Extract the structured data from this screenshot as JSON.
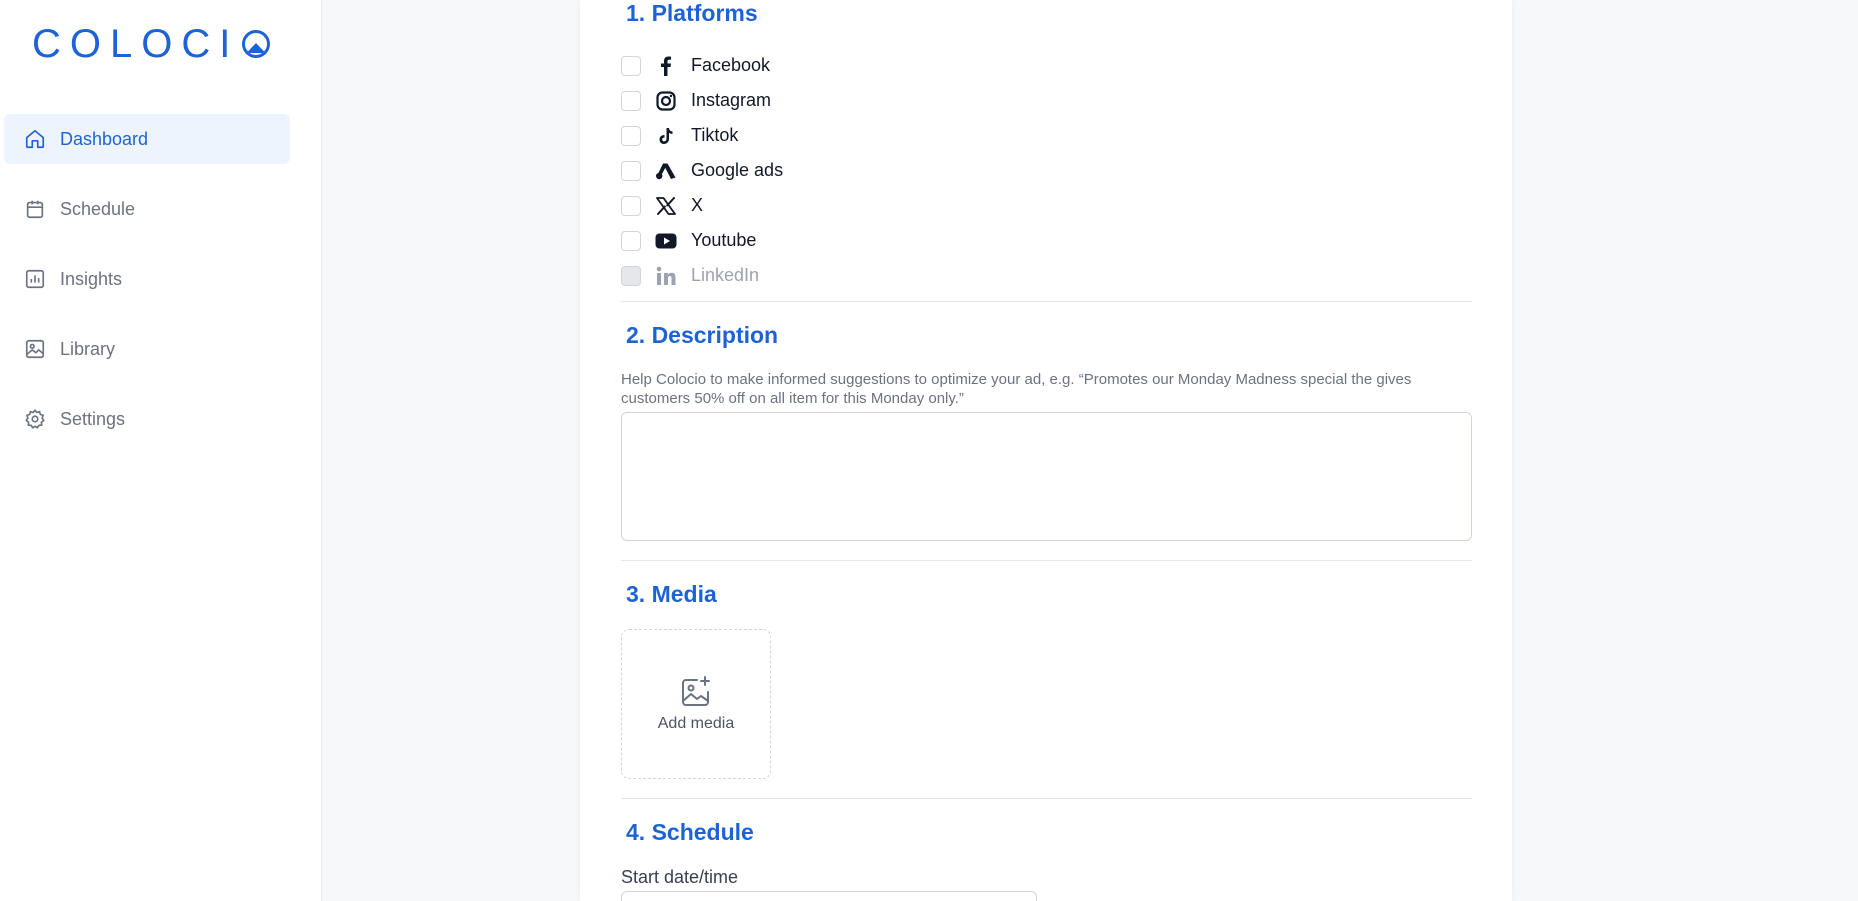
{
  "brand": {
    "logo_text": "COLOCI",
    "accent": "#1e63d6"
  },
  "sidebar": {
    "items": [
      {
        "label": "Dashboard",
        "icon": "home-icon",
        "active": true
      },
      {
        "label": "Schedule",
        "icon": "calendar-icon"
      },
      {
        "label": "Insights",
        "icon": "bar-chart-icon"
      },
      {
        "label": "Library",
        "icon": "image-icon"
      },
      {
        "label": "Settings",
        "icon": "gear-icon"
      }
    ]
  },
  "form": {
    "platforms": {
      "title": "1. Platforms",
      "options": [
        {
          "label": "Facebook",
          "icon": "facebook-icon",
          "checked": false,
          "disabled": false
        },
        {
          "label": "Instagram",
          "icon": "instagram-icon",
          "checked": false,
          "disabled": false
        },
        {
          "label": "Tiktok",
          "icon": "tiktok-icon",
          "checked": false,
          "disabled": false
        },
        {
          "label": "Google ads",
          "icon": "google-ads-icon",
          "checked": false,
          "disabled": false
        },
        {
          "label": "X",
          "icon": "x-icon",
          "checked": false,
          "disabled": false
        },
        {
          "label": "Youtube",
          "icon": "youtube-icon",
          "checked": false,
          "disabled": false
        },
        {
          "label": "LinkedIn",
          "icon": "linkedin-icon",
          "checked": false,
          "disabled": true
        }
      ]
    },
    "description": {
      "title": "2. Description",
      "help": "Help Colocio to make informed suggestions to optimize your ad, e.g. “Promotes our Monday Madness special the gives customers 50% off on all item for this Monday only.”",
      "value": ""
    },
    "media": {
      "title": "3. Media",
      "add_label": "Add media"
    },
    "schedule": {
      "title": "4. Schedule",
      "start_label": "Start date/time",
      "start_value": ""
    }
  }
}
